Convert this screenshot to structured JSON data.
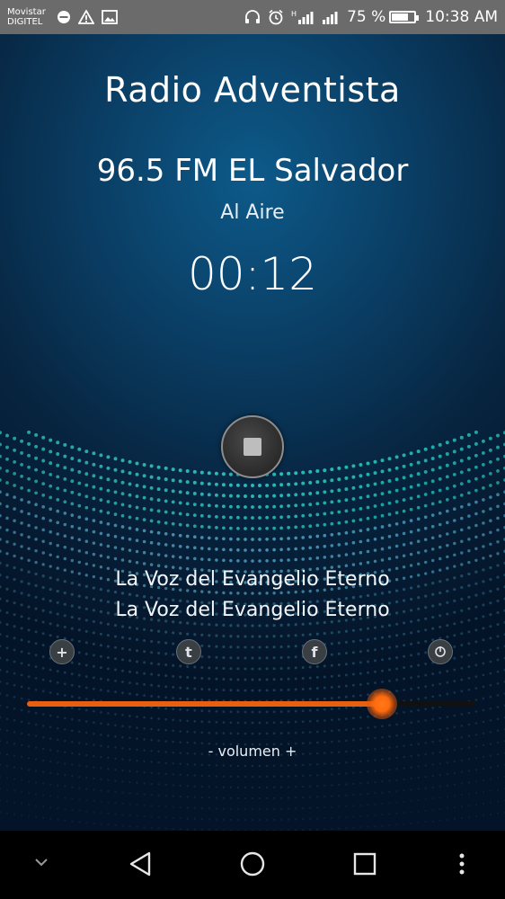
{
  "status_bar": {
    "carrier_line1": "Movistar",
    "carrier_line2": "DIGITEL",
    "battery_text": "75 %",
    "battery_level": 0.75,
    "time": "10:38 AM",
    "icons": [
      "dnd-icon",
      "warning-icon",
      "image-icon",
      "headphones-icon",
      "alarm-icon",
      "signal-h-icon",
      "signal-icon",
      "battery-icon"
    ]
  },
  "player": {
    "title": "Radio Adventista",
    "station": "96.5 FM EL Salvador",
    "status": "Al Aire",
    "elapsed": "00:12",
    "program_line1": "La Voz del Evangelio Eterno",
    "program_line2": "La Voz del Evangelio Eterno",
    "volume_label": "- volumen +",
    "volume_level": 0.79,
    "accent_color": "#e8600f"
  },
  "social": {
    "add": "+",
    "twitter": "t",
    "facebook": "f",
    "power": "o"
  },
  "nav": [
    "chevron-down-icon",
    "back-icon",
    "home-icon",
    "recents-icon",
    "more-icon"
  ]
}
